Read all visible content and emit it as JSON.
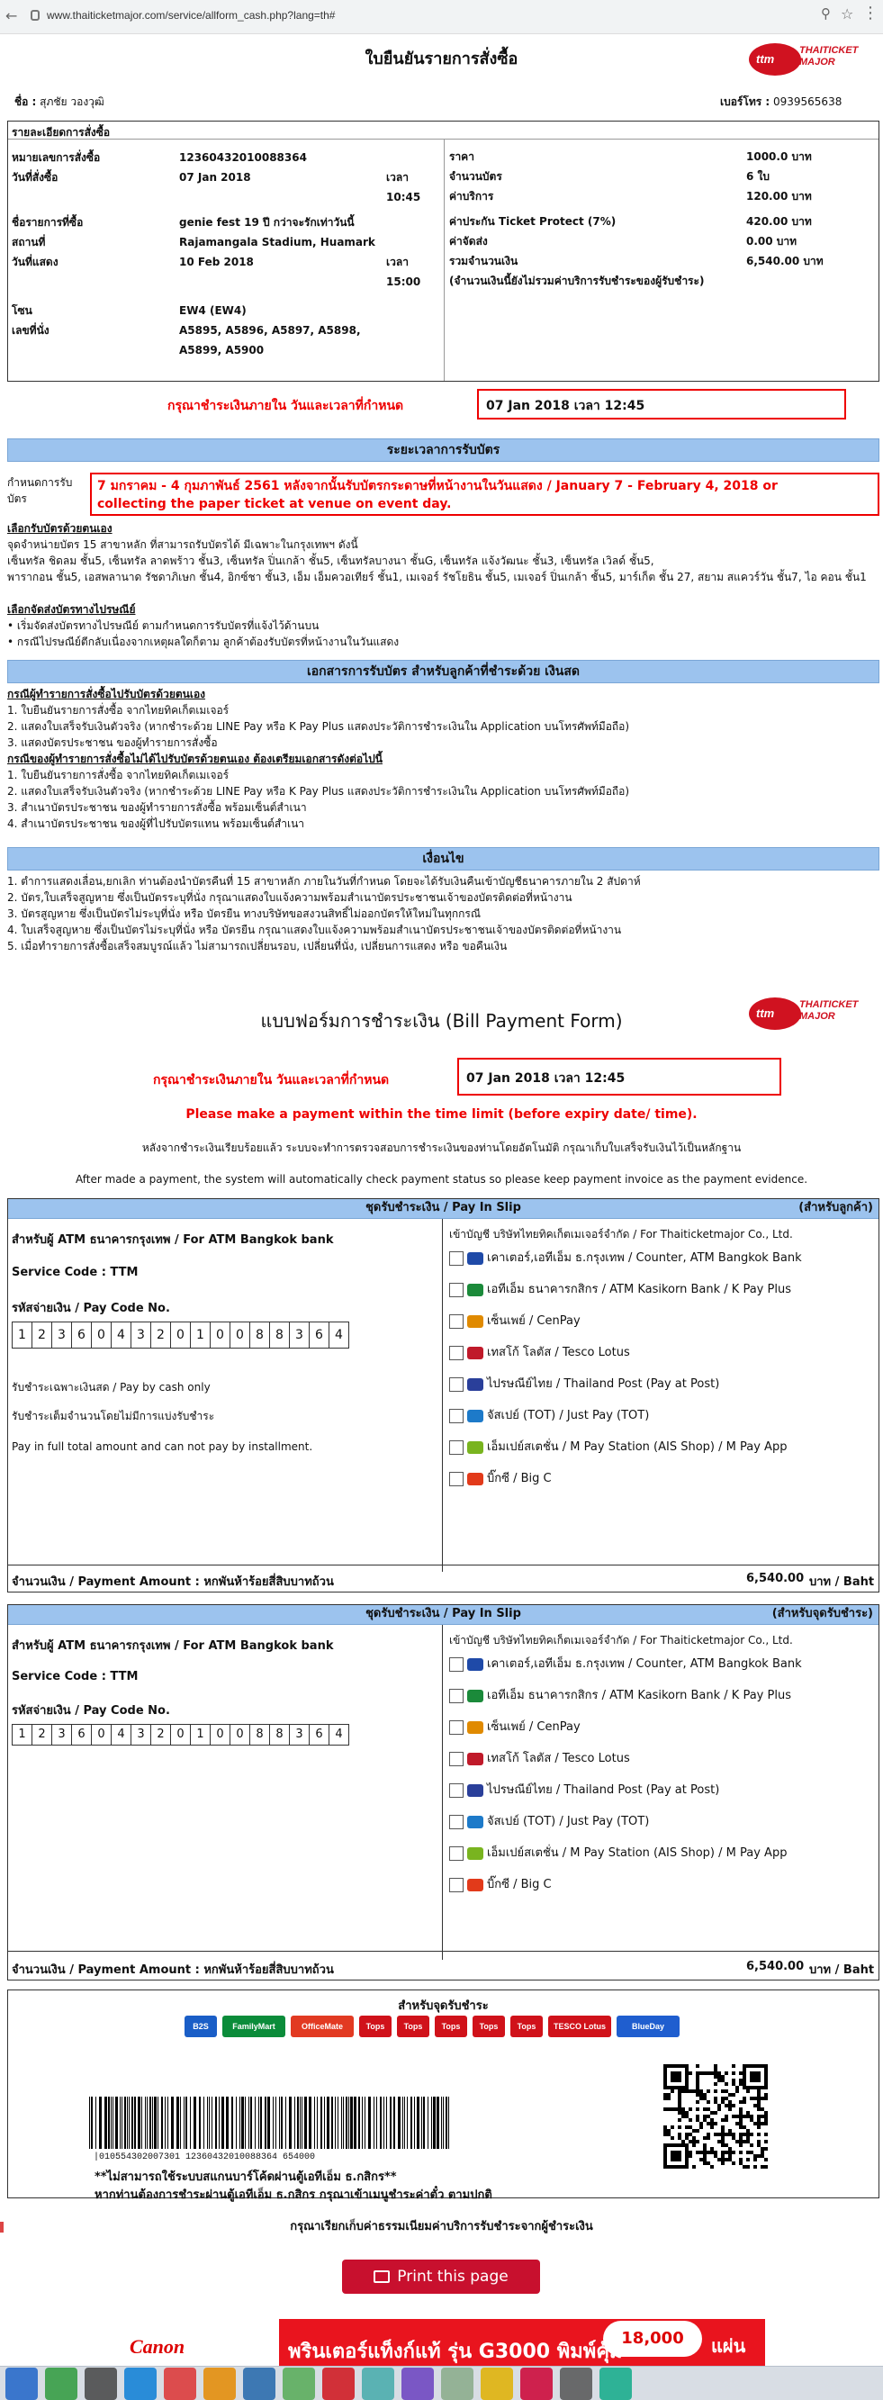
{
  "browser": {
    "url": "www.thaiticketmajor.com/service/allform_cash.php?lang=th#"
  },
  "logo": {
    "brand_mark": "ttm",
    "brand_text": "THAITICKET MAJOR"
  },
  "confirm": {
    "title": "ใบยืนยันรายการสั่งซื้อ",
    "name_label": "ชื่อ :",
    "name_value": "สุภชัย วองวุฒิ",
    "phone_label": "เบอร์โทร :",
    "phone_value": "0939565638",
    "details_label": "รายละเอียดการสั่งซื้อ",
    "order_no_label": "หมายเลขการสั่งซื้อ",
    "order_no": "12360432010088364",
    "order_date_label": "วันที่สั่งซื้อ",
    "order_date": "07 Jan 2018",
    "time_label": "เวลา",
    "order_time": "10:45",
    "event_label": "ชื่อรายการที่ซื้อ",
    "event": "genie fest 19 ปี กว่าจะรักเท่าวันนี้",
    "venue_label": "สถานที่",
    "venue": "Rajamangala Stadium, Huamark",
    "show_date_label": "วันที่แสดง",
    "show_date": "10 Feb 2018",
    "show_time": "15:00",
    "zone_label": "โซน",
    "zone": "EW4 (EW4)",
    "seat_label": "เลขที่นั่ง",
    "seats1": "A5895, A5896, A5897, A5898,",
    "seats2": "A5899, A5900",
    "price_label": "ราคา",
    "price": "1000.0 บาท",
    "qty_label": "จำนวนบัตร",
    "qty": "6 ใบ",
    "service_label": "ค่าบริการ",
    "service": "120.00 บาท",
    "insurance_label": "ค่าประกัน Ticket Protect (7%)",
    "insurance": "420.00 บาท",
    "delivery_label": "ค่าจัดส่ง",
    "delivery": "0.00 บาท",
    "total_label": "รวมจำนวนเงิน",
    "total": "6,540.00 บาท",
    "note": "(จำนวนเงินนี้ยังไม่รวมค่าบริการรับชำระของผู้รับชำระ)",
    "pay_within_label": "กรุณาชำระเงินภายใน วันและเวลาที่กำหนด",
    "pay_within_value": "07 Jan 2018 เวลา 12:45"
  },
  "pickup": {
    "header": "ระยะเวลาการรับบัตร",
    "period_label1": "กำหนดการรับ",
    "period_label2": "บัตร",
    "period_line1": "7 มกราคม - 4 กุมภาพันธ์ 2561 หลังจากนั้นรับบัตรกระดาษที่หน้างานในวันแสดง / January 7 - February 4, 2018 or",
    "period_line2": "collecting the paper ticket at venue on event day.",
    "self_title": "เลือกรับบัตรด้วยตนเอง",
    "self_text1": "จุดจำหน่ายบัตร 15 สาขาหลัก ที่สามารถรับบัตรได้ มีเฉพาะในกรุงเทพฯ ดังนี้",
    "self_text2": "เซ็นทรัล ชิดลม ชั้น5, เซ็นทรัล ลาดพร้าว ชั้น3, เซ็นทรัล ปิ่นเกล้า ชั้น5, เซ็นทรัลบางนา ชั้นG, เซ็นทรัล แจ้งวัฒนะ ชั้น3, เซ็นทรัล เวิลด์ ชั้น5,",
    "self_text3": "พารากอน ชั้น5, เอสพลานาด รัชดาภิเษก ชั้น4, อิกซ์ชา ชั้น3, เอ็ม เอ็มควอเทียร์ ชั้น1, เมเจอร์ รัชโยธิน ชั้น5, เมเจอร์ ปิ่นเกล้า ชั้น5, มาร์เก็ต ชั้น 27, สยาม สแควร์วัน ชั้น7, ไอ คอน ชั้น1",
    "mail_title": "เลือกจัดส่งบัตรทางไปรษณีย์",
    "mail_text1": "• เริ่มจัดส่งบัตรทางไปรษณีย์ ตามกำหนดการรับบัตรที่แจ้งไว้ด้านบน",
    "mail_text2": "• กรณีไปรษณีย์ตีกลับเนื่องจากเหตุผลใดก็ตาม ลูกค้าต้องรับบัตรที่หน้างานในวันแสดง"
  },
  "docs": {
    "header": "เอกสารการรับบัตร สำหรับลูกค้าที่ชำระด้วย เงินสด",
    "self_title": "กรณีผู้ทำรายการสั่งซื้อไปรับบัตรด้วยตนเอง",
    "self1": "1. ใบยืนยันรายการสั่งซื้อ จากไทยทิคเก็ตเมเจอร์",
    "self2": "2. แสดงใบเสร็จรับเงินตัวจริง (หากชำระด้วย LINE Pay หรือ K Pay Plus แสดงประวัติการชำระเงินใน Application บนโทรศัพท์มือถือ)",
    "self3": "3. แสดงบัตรประชาชน ของผู้ทำรายการสั่งซื้อ",
    "other_title": "กรณีของผู้ทำรายการสั่งซื้อไม่ได้ไปรับบัตรด้วยตนเอง ต้องเตรียมเอกสารดังต่อไปนี้",
    "other1": "1. ใบยืนยันรายการสั่งซื้อ จากไทยทิคเก็ตเมเจอร์",
    "other2": "2. แสดงใบเสร็จรับเงินตัวจริง (หากชำระด้วย LINE Pay หรือ K Pay Plus แสดงประวัติการชำระเงินใน Application บนโทรศัพท์มือถือ)",
    "other3": "3. สำเนาบัตรประชาชน ของผู้ทำรายการสั่งซื้อ พร้อมเซ็นต์สำเนา",
    "other4": "4. สำเนาบัตรประชาชน ของผู้ที่ไปรับบัตรแทน พร้อมเซ็นต์สำเนา"
  },
  "terms": {
    "header": "เงื่อนไข",
    "t1": "1. ตำการแสดงเลื่อน,ยกเลิก ท่านต้องนำบัตรคืนที่ 15 สาขาหลัก ภายในวันที่กำหนด โดยจะได้รับเงินคืนเข้าบัญชีธนาคารภายใน 2 สัปดาห์",
    "t2": "2. บัตร,ใบเสร็จสูญหาย ซึ่งเป็นบัตรระบุที่นั่ง กรุณาแสดงใบแจ้งความพร้อมสำเนาบัตรประชาชนเจ้าของบัตรติดต่อที่หน้างาน",
    "t3": "3. บัตรสูญหาย ซึ่งเป็นบัตรไม่ระบุที่นั่ง หรือ บัตรยืน ทางบริษัทขอสงวนสิทธิ์ไม่ออกบัตรให้ใหม่ในทุกกรณี",
    "t4": "4. ใบเสร็จสูญหาย ซึ่งเป็นบัตรไม่ระบุที่นั่ง หรือ บัตรยืน กรุณาแสดงใบแจ้งความพร้อมสำเนาบัตรประชาชนเจ้าของบัตรติดต่อที่หน้างาน",
    "t5": "5. เมื่อทำรายการสั่งซื้อเสร็จสมบูรณ์แล้ว ไม่สามารถเปลี่ยนรอบ, เปลี่ยนที่นั่ง, เปลี่ยนการแสดง หรือ ขอคืนเงิน"
  },
  "bill": {
    "title": "แบบฟอร์มการชำระเงิน (Bill Payment Form)",
    "pay_within_label": "กรุณาชำระเงินภายใน วันและเวลาที่กำหนด",
    "pay_within_value": "07 Jan 2018 เวลา 12:45",
    "warning": "Please make a payment within the time limit (before expiry date/ time).",
    "info_th": "หลังจากชำระเงินเรียบร้อยแล้ว ระบบจะทำการตรวจสอบการชำระเงินของท่านโดยอัตโนมัติ กรุณาเก็บใบเสร็จรับเงินไว้เป็นหลักฐาน",
    "info_en": "After made a payment, the system will automatically check payment status so please keep payment invoice as the payment evidence."
  },
  "slip1": {
    "title": "ชุดรับชำระเงิน / Pay In Slip",
    "for": "(สำหรับลูกค้า)",
    "bank": "สำหรับผู้ ATM ธนาคารกรุงเทพ / For ATM Bangkok bank",
    "service_code": "Service Code : TTM",
    "pay_code_label": "รหัสจ่ายเงิน / Pay Code No.",
    "cash_only": "รับชำระเฉพาะเงินสด / Pay by cash only",
    "full_th": "รับชำระเต็มจำนวนโดยไม่มีการแบ่งรับชำระ",
    "full_en": "Pay in full total amount and can not pay by installment.",
    "amount_label": "จำนวนเงิน / Payment Amount : หกพันห้าร้อยสี่สิบบาทถ้วน",
    "amount": "6,540.00",
    "unit": "บาท / Baht"
  },
  "slip2": {
    "title": "ชุดรับชำระเงิน / Pay In Slip",
    "for": "(สำหรับจุดรับชำระ)",
    "bank": "สำหรับผู้ ATM ธนาคารกรุงเทพ / For ATM Bangkok bank",
    "service_code": "Service Code : TTM",
    "pay_code_label": "รหัสจ่ายเงิน / Pay Code No.",
    "amount_label": "จำนวนเงิน / Payment Amount : หกพันห้าร้อยสี่สิบบาทถ้วน",
    "amount": "6,540.00",
    "unit": "บาท / Baht"
  },
  "pay_code": [
    "1",
    "2",
    "3",
    "6",
    "0",
    "4",
    "3",
    "2",
    "0",
    "1",
    "0",
    "0",
    "8",
    "8",
    "3",
    "6",
    "4"
  ],
  "channels": {
    "header": "เข้าบัญชี บริษัทไทยทิคเก็ตเมเจอร์จำกัด / For Thaiticketmajor Co., Ltd.",
    "items": [
      "เคาเตอร์,เอทีเอ็ม ธ.กรุงเทพ / Counter, ATM Bangkok Bank",
      "เอทีเอ็ม ธนาคารกสิกร / ATM Kasikorn Bank / K Pay Plus",
      "เซ็นเพย์ / CenPay",
      "เทสโก้ โลตัส / Tesco Lotus",
      "ไปรษณีย์ไทย / Thailand Post (Pay at Post)",
      "จัสเปย์ (TOT) / Just Pay (TOT)",
      "เอ็มเปย์สเตชั่น / M Pay Station (AIS Shop) / M Pay App",
      "บิ๊กซี / Big C"
    ]
  },
  "counter": {
    "title": "สำหรับจุดรับชำระ",
    "logos": [
      "B2S",
      "FamilyMart",
      "OfficeMate",
      "Tops",
      "Tops",
      "Tops",
      "Tops",
      "Tops",
      "TESCO Lotus",
      "BlueDay"
    ],
    "barcode_text": "|010554302007301 12360432010088364 654000",
    "note1": "**ไม่สามารถใช้ระบบสแกนบาร์โค้ดผ่านตู้เอทีเอ็ม ธ.กสิกร**",
    "note2": "หากท่านต้องการชำระผ่านตู้เอทีเอ็ม ธ.กสิกร กรุณาเข้าเมนูชำระค่าตั๋ว ตามปกติ",
    "fee_note": "กรุณาเรียกเก็บค่าธรรมเนียมค่าบริการรับชำระจากผู้ชำระเงิน"
  },
  "print_button": "Print this page",
  "ad": {
    "brand": "Canon",
    "text": "พรินเตอร์แท็งก์แท้ รุ่น G3000 พิมพ์คุ้ม",
    "badge": "18,000",
    "badge_unit": "แผ่น"
  },
  "colors": {
    "header_bg": "#9cc3ee",
    "accent_red": "#e00000",
    "print_btn": "#c8102e",
    "taskbar": "#d8dde4"
  }
}
